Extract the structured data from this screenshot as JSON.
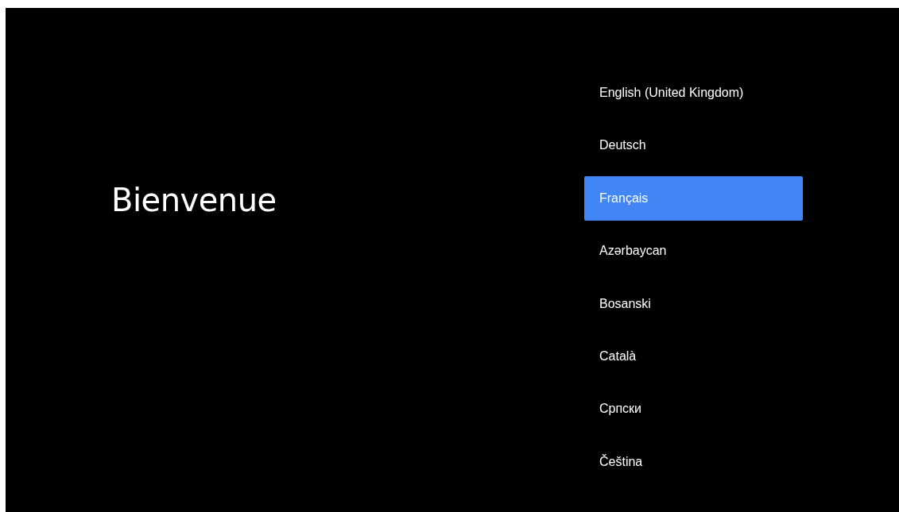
{
  "title": "Bienvenue",
  "languages": [
    {
      "label": "English (United Kingdom)",
      "selected": false
    },
    {
      "label": "Deutsch",
      "selected": false
    },
    {
      "label": "Français",
      "selected": true
    },
    {
      "label": "Azərbaycan",
      "selected": false
    },
    {
      "label": "Bosanski",
      "selected": false
    },
    {
      "label": "Català",
      "selected": false
    },
    {
      "label": "Српски",
      "selected": false
    },
    {
      "label": "Čeština",
      "selected": false
    }
  ]
}
